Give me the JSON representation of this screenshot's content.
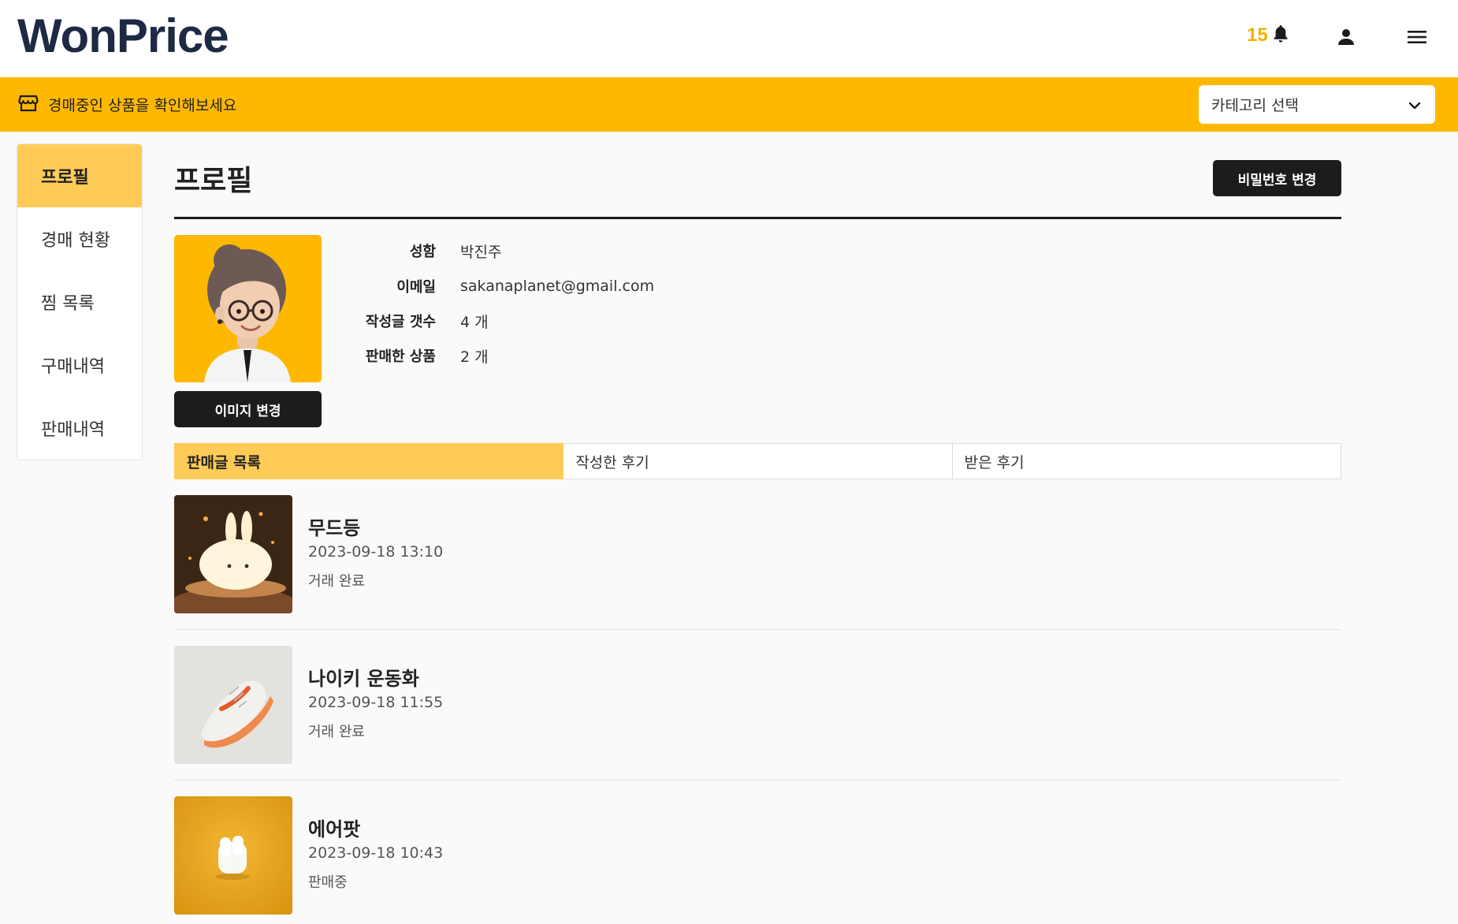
{
  "header": {
    "logo": "WonPrice",
    "notification_count": "15"
  },
  "banner": {
    "text": "경매중인 상품을 확인해보세요",
    "category_placeholder": "카테고리 선택"
  },
  "sidebar": {
    "items": [
      {
        "label": "프로필",
        "active": true
      },
      {
        "label": "경매 현황"
      },
      {
        "label": "찜 목록"
      },
      {
        "label": "구매내역"
      },
      {
        "label": "판매내역"
      }
    ]
  },
  "profile": {
    "title": "프로필",
    "change_password_label": "비밀번호 변경",
    "change_image_label": "이미지 변경",
    "fields": [
      {
        "label": "성함",
        "value": "박진주"
      },
      {
        "label": "이메일",
        "value": "sakanaplanet@gmail.com"
      },
      {
        "label": "작성글 갯수",
        "value": "4 개"
      },
      {
        "label": "판매한 상품",
        "value": "2 개"
      }
    ]
  },
  "tabs": [
    {
      "label": "판매글 목록",
      "active": true
    },
    {
      "label": "작성한 후기"
    },
    {
      "label": "받은 후기"
    }
  ],
  "posts": [
    {
      "title": "무드등",
      "date": "2023-09-18 13:10",
      "status": "거래 완료"
    },
    {
      "title": "나이키 운동화",
      "date": "2023-09-18 11:55",
      "status": "거래 완료"
    },
    {
      "title": "에어팟",
      "date": "2023-09-18 10:43",
      "status": "판매중"
    }
  ],
  "colors": {
    "accent": "#ffb800",
    "accent_light": "#ffcb57",
    "dark": "#1c1c1c",
    "logo": "#1e2a44"
  }
}
